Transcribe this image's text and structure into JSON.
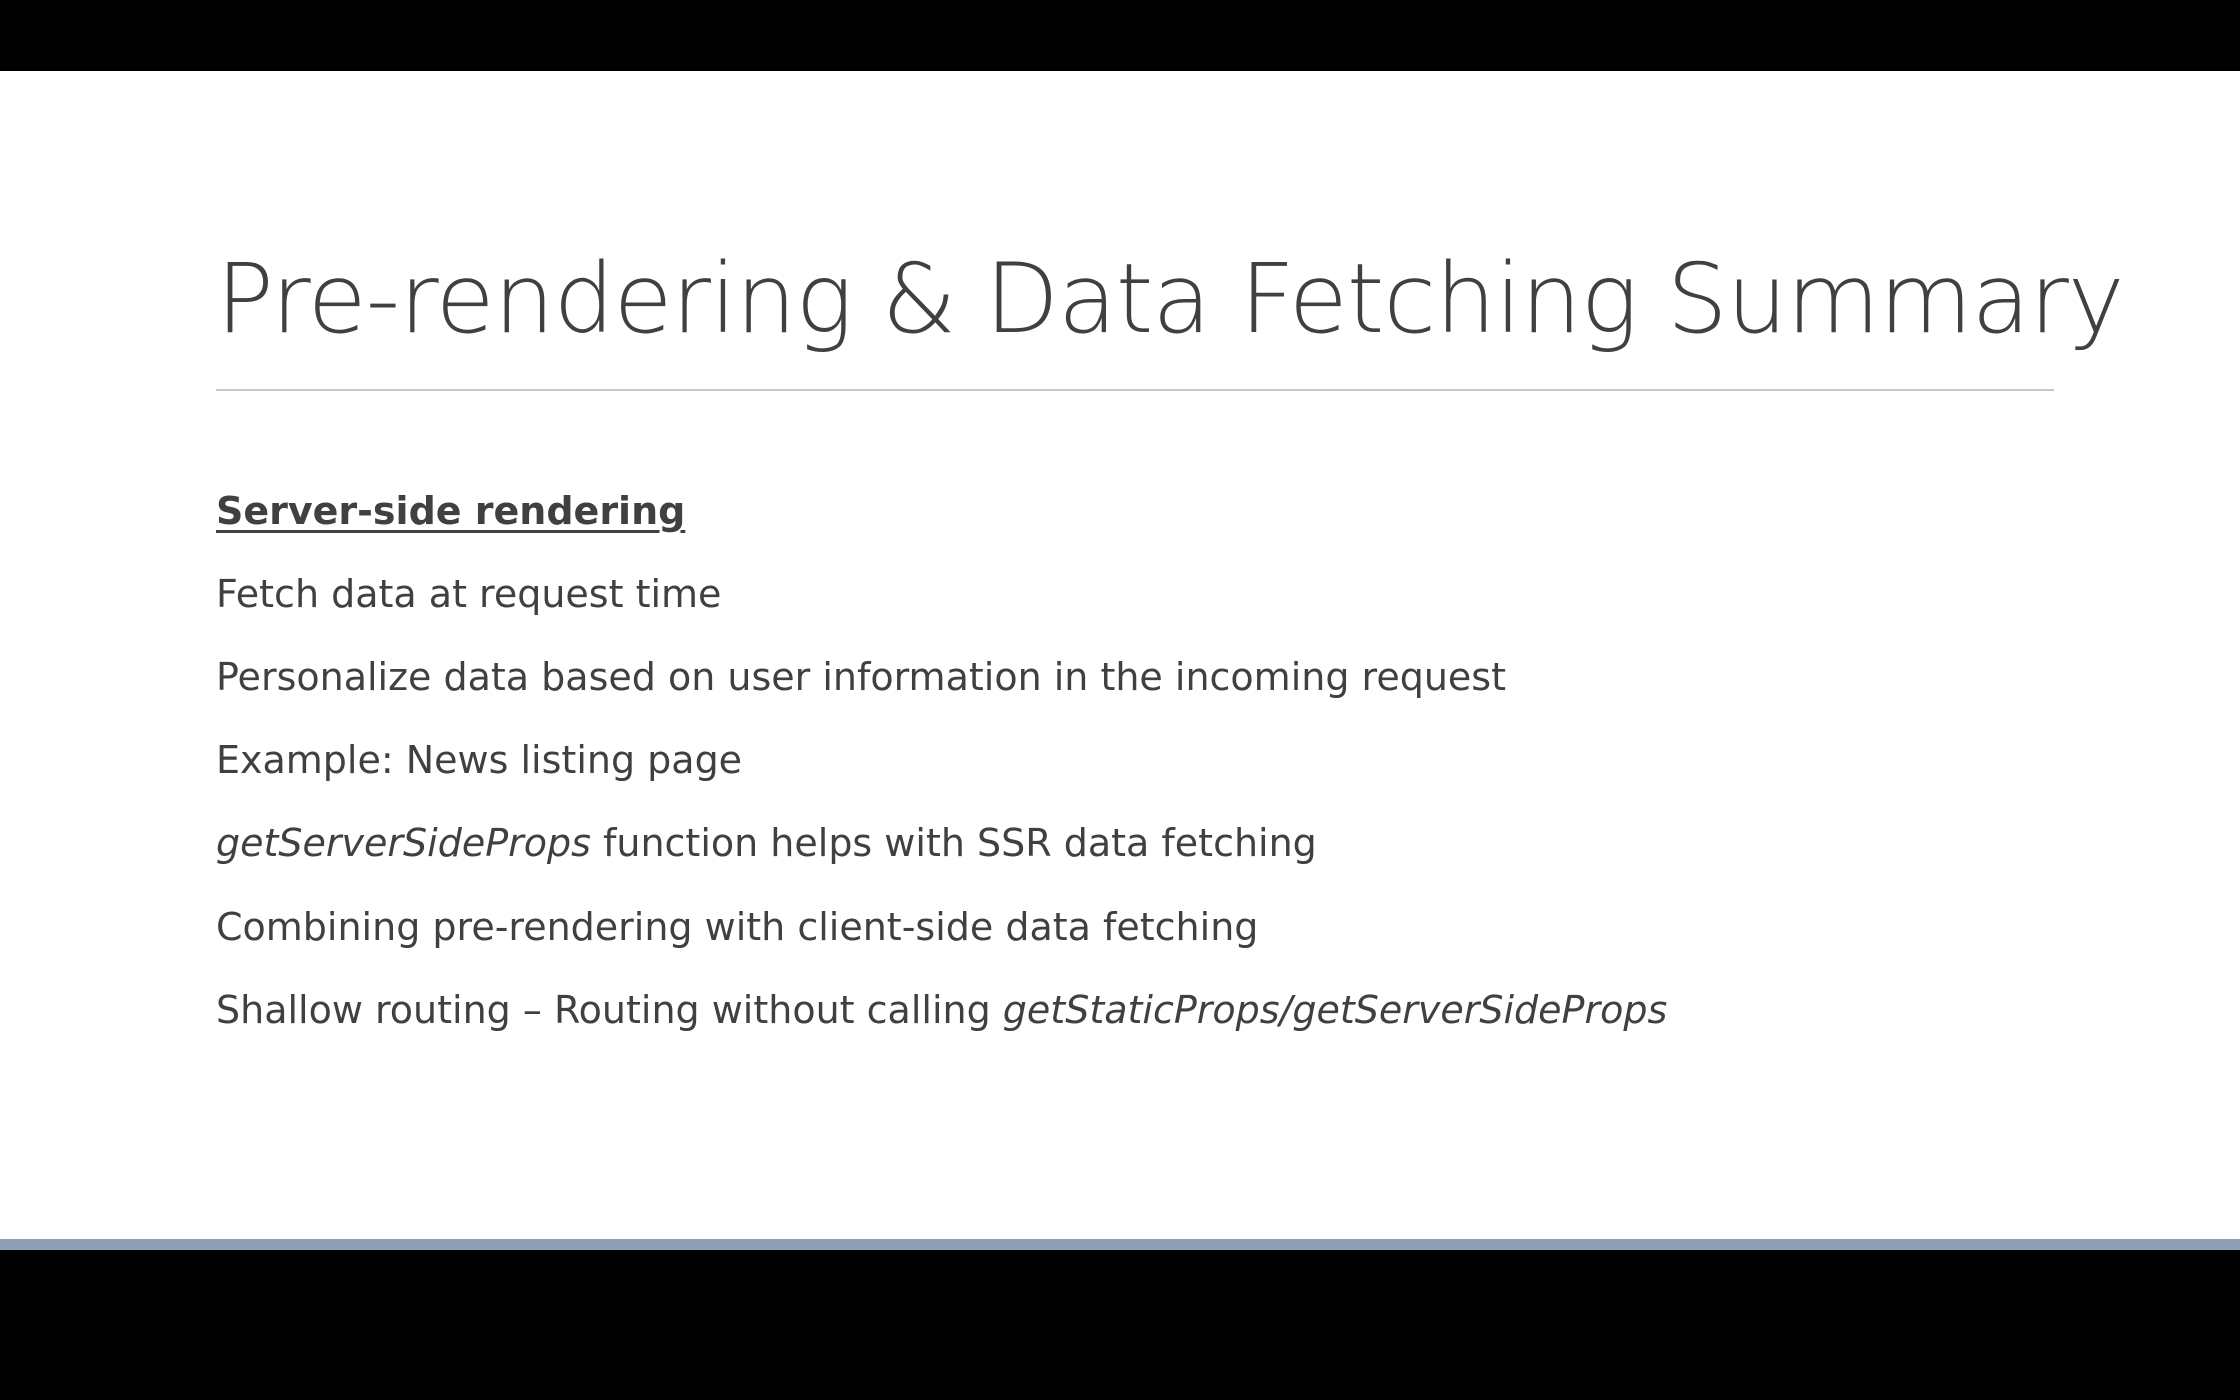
{
  "slide": {
    "title": "Pre-rendering & Data Fetching Summary",
    "heading": "Server-side rendering",
    "line1": "Fetch data at request time",
    "line2": "Personalize data based on user information in the incoming request",
    "line3": "Example: News listing page",
    "line4_italic": "getServerSideProps",
    "line4_rest": " function helps with SSR data fetching",
    "line5": "Combining pre-rendering with client-side data fetching",
    "line6_start": "Shallow routing – Routing without calling ",
    "line6_italic": "getStaticProps/getServerSideProps"
  },
  "colors": {
    "text": "#404040",
    "accent_bar": "#8ea0b6",
    "frame": "#000000"
  }
}
